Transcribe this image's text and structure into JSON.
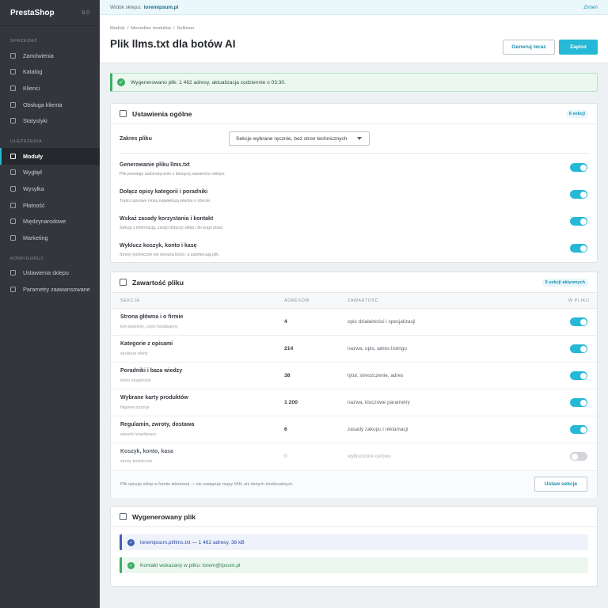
{
  "brand": {
    "name": "PrestaShop",
    "version": "9.0"
  },
  "sidebar": {
    "sections": [
      {
        "label": "SPRZEDAŻ",
        "items": [
          {
            "label": "Zamówienia"
          },
          {
            "label": "Katalog"
          },
          {
            "label": "Klienci"
          },
          {
            "label": "Obsługa klienta"
          },
          {
            "label": "Statystyki"
          }
        ]
      },
      {
        "label": "ULEPSZENIA",
        "items": [
          {
            "label": "Moduły",
            "active": true
          },
          {
            "label": "Wygląd"
          },
          {
            "label": "Wysyłka"
          },
          {
            "label": "Płatność"
          },
          {
            "label": "Międzynarodowe"
          },
          {
            "label": "Marketing"
          }
        ]
      },
      {
        "label": "KONFIGURUJ",
        "items": [
          {
            "label": "Ustawienia sklepu"
          },
          {
            "label": "Parametry zaawansowane"
          }
        ]
      }
    ]
  },
  "topbar": {
    "shop_label": "Widok sklepu:",
    "shop_name": "loremipsum.pl",
    "change": "Zmień"
  },
  "header": {
    "breadcrumb": [
      "Moduły",
      "Menedżer modułów",
      "Sellision"
    ],
    "title": "Plik llms.txt dla botów AI",
    "generate_label": "Generuj teraz",
    "save_label": "Zapisz"
  },
  "alert": {
    "text": "Wygenerowano plik: 1 462 adresy, aktualizacja codziennie o 03:30."
  },
  "general": {
    "title": "Ustawienia ogólne",
    "badge": "6 sekcji",
    "scope_label": "Zakres pliku",
    "scope_value": "Sekcje wybrane ręcznie, bez stron technicznych",
    "options": [
      {
        "title": "Generowanie pliku llms.txt",
        "desc": "Plik powstaje automatycznie z bieżącej zawartości sklepu.",
        "on": true
      },
      {
        "title": "Dołącz opisy kategorii i poradniki",
        "desc": "Treści opisowe niosą największą wiedzę o ofercie.",
        "on": true
      },
      {
        "title": "Wskaż zasady korzystania i kontakt",
        "desc": "Sekcja z informacją, czego dotyczy sklep i do kogo pisać.",
        "on": true
      },
      {
        "title": "Wyklucz koszyk, konto i kasę",
        "desc": "Strony techniczne nie wnoszą treści, a zaśmiecają plik.",
        "on": true
      }
    ]
  },
  "content": {
    "title": "Zawartość pliku",
    "badge": "5 sekcji aktywnych",
    "columns": {
      "section": "SEKCJA",
      "addresses": "ADRESÓW",
      "content": "ZAWARTOŚĆ",
      "in_file": "W PLIKU"
    },
    "rows": [
      {
        "name": "Strona główna i o firmie",
        "sub": "kim jesteśmy, czym handlujemy",
        "count": "4",
        "content": "opis działalności i specjalizacji",
        "on": true
      },
      {
        "name": "Kategorie z opisami",
        "sub": "struktura oferty",
        "count": "214",
        "content": "nazwa, opis, adres listingu",
        "on": true
      },
      {
        "name": "Poradniki i baza wiedzy",
        "sub": "treści eksperckie",
        "count": "38",
        "content": "tytuł, streszczenie, adres",
        "on": true
      },
      {
        "name": "Wybrane karty produktów",
        "sub": "flagowe pozycje",
        "count": "1 200",
        "content": "nazwa, kluczowe parametry",
        "on": true
      },
      {
        "name": "Regulamin, zwroty, dostawa",
        "sub": "warunki współpracy",
        "count": "6",
        "content": "zasady zakupu i reklamacji",
        "on": true
      },
      {
        "name": "Koszyk, konto, kasa",
        "sub": "strony techniczne",
        "count": "0",
        "content": "wykluczone celowo",
        "on": false
      }
    ],
    "footer_note": "Plik opisuje sklep w formie tekstowej — nie zastępuje mapy XML ani danych strukturalnych.",
    "footer_button": "Ustaw sekcje"
  },
  "generated": {
    "title": "Wygenerowany plik",
    "file_info": "loremipsum.pl/llms.txt — 1 462 adresy, 38 kB",
    "contact_info": "Kontakt wskazany w pliku: lorem@ipsum.pl"
  },
  "colors": {
    "accent": "#25b9d7",
    "sidebar": "#33373d",
    "success": "#3cae63",
    "info": "#3f5fb6"
  }
}
